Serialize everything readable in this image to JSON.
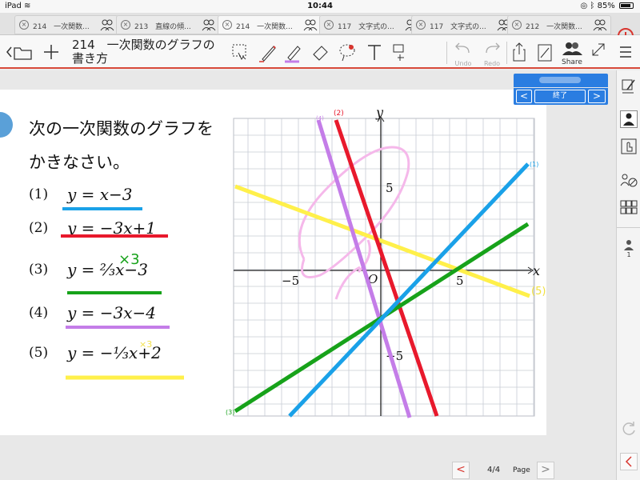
{
  "status_bar": {
    "device": "iPad",
    "time": "10:44",
    "battery": "85%"
  },
  "tabs": [
    {
      "label": "214　一次関数..."
    },
    {
      "label": "213　直線の傾..."
    },
    {
      "label": "214　一次関数..."
    },
    {
      "label": "117　文字式の..."
    },
    {
      "label": "117　文字式の..."
    },
    {
      "label": "212　一次関数..."
    }
  ],
  "toolbar": {
    "title_line1": "214　一次関数のグラフの",
    "title_line2": "書き方",
    "undo_label": "Undo",
    "redo_label": "Redo",
    "share_label": "Share"
  },
  "timer": {
    "end_label": "終了",
    "prev": "<",
    "next": ">"
  },
  "problem": {
    "prompt_line1": "次の一次関数のグラフを",
    "prompt_line2": "かきなさい。",
    "items": [
      {
        "num": "(1)",
        "eq": "y = x−3"
      },
      {
        "num": "(2)",
        "eq": "y = −3x+1"
      },
      {
        "num": "(3)",
        "eq": "y = ⅔x−3"
      },
      {
        "num": "(4)",
        "eq": "y = −3x−4"
      },
      {
        "num": "(5)",
        "eq": "y = −⅓x+2"
      }
    ],
    "frac3_num": "2",
    "frac3_den": "3",
    "frac5_num": "1",
    "frac5_den": "3",
    "annot3": "×3",
    "annot5": "×3"
  },
  "graph": {
    "x_axis_label": "x",
    "y_axis_label": "y",
    "tick_x_neg": "−5",
    "tick_x_pos": "5",
    "tick_y_pos": "5",
    "tick_y_neg": "−5",
    "origin": "O",
    "line_labels": {
      "l1": "(1)",
      "l2": "(2)",
      "l3": "(3)",
      "l4": "(4)",
      "l5": "(5)"
    }
  },
  "pager": {
    "page": "4/4",
    "label": "Page",
    "prev": "<",
    "next": ">"
  },
  "right_panel": {
    "participants_count": "1"
  },
  "colors": {
    "blue": "#1aa1e8",
    "red": "#e8192c",
    "green": "#17a21a",
    "purple": "#c47de8",
    "yellow": "#fff04a",
    "accent": "#2a7de1"
  }
}
